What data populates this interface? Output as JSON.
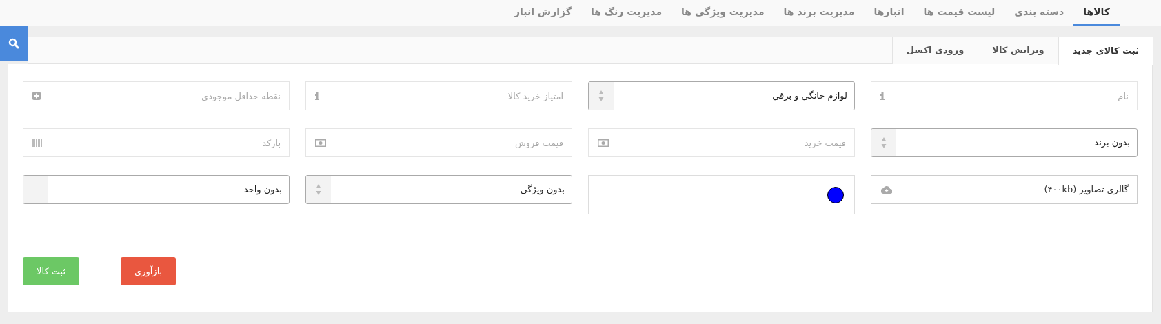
{
  "nav_tabs": [
    {
      "label": "کالاها",
      "selected": true
    },
    {
      "label": "دسته بندی",
      "selected": false
    },
    {
      "label": "لیست قیمت ها",
      "selected": false
    },
    {
      "label": "انبارها",
      "selected": false
    },
    {
      "label": "مدیریت برند ها",
      "selected": false
    },
    {
      "label": "مدیریت ویژگی ها",
      "selected": false
    },
    {
      "label": "مدیریت رنگ ها",
      "selected": false
    },
    {
      "label": "گزارش انبار",
      "selected": false
    }
  ],
  "sub_tabs": [
    {
      "label": "ثبت کالای جدید",
      "selected": true
    },
    {
      "label": "ویرایش کالا",
      "selected": false
    },
    {
      "label": "ورودی اکسل",
      "selected": false
    }
  ],
  "fields": [
    {
      "kind": "info",
      "placeholder": "نام"
    },
    {
      "kind": "select",
      "value": "لوازم خانگی و برقی",
      "arrows": true
    },
    {
      "kind": "info",
      "placeholder": "امتیاز خرید کالا"
    },
    {
      "kind": "stock",
      "placeholder": "نقطه حداقل موجودی"
    },
    {
      "kind": "select",
      "value": "بدون برند",
      "arrows": true
    },
    {
      "kind": "price",
      "placeholder": "قیمت خرید"
    },
    {
      "kind": "price",
      "placeholder": "قیمت فروش"
    },
    {
      "kind": "barcode",
      "placeholder": "بارکد"
    },
    {
      "kind": "file",
      "value": "گالری تصاویر (۴۰۰kb)"
    },
    {
      "kind": "color",
      "color": "#0000ff"
    },
    {
      "kind": "select",
      "value": "بدون ویژگی",
      "arrows": true
    },
    {
      "kind": "select",
      "value": "بدون واحد",
      "arrows": false
    }
  ],
  "buttons": [
    {
      "label": "بازآوری",
      "kind": "reset"
    },
    {
      "label": "ثبت کالا",
      "kind": "submit"
    }
  ]
}
